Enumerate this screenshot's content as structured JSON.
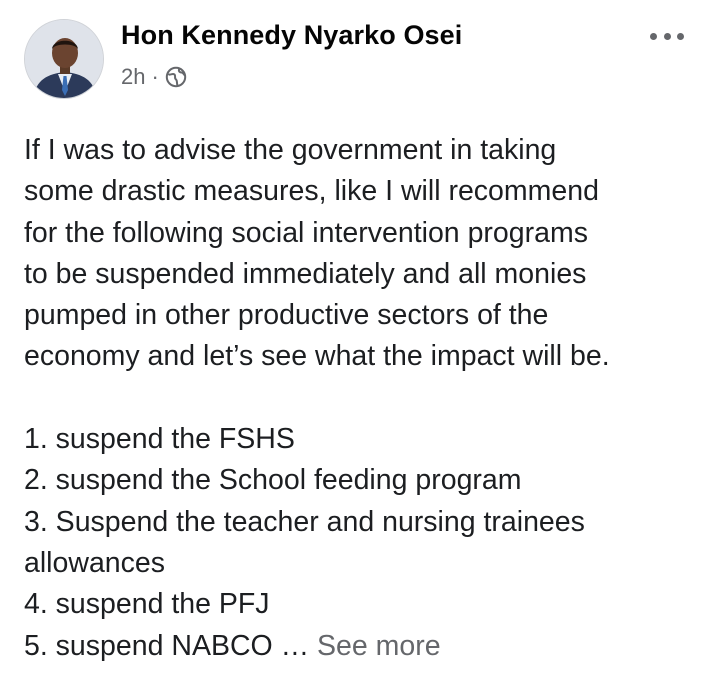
{
  "post": {
    "author": "Hon Kennedy Nyarko Osei",
    "timestamp": "2h",
    "separator": "·",
    "privacy_icon": "globe-icon",
    "options_icon": "more-options-icon",
    "body_lines": [
      "If I was to advise the government in taking",
      "some drastic measures,  like I will recommend",
      "for the following social intervention programs",
      "to be suspended immediately and  all monies",
      "pumped in other productive sectors of the",
      "economy and let’s see what the impact will be."
    ],
    "list_lines": [
      "1. suspend the FSHS",
      "2. suspend the School feeding program",
      "3. Suspend the teacher and nursing trainees",
      "allowances",
      "4. suspend the PFJ"
    ],
    "last_line_text": "5. suspend NABCO … ",
    "see_more": "See more"
  },
  "colors": {
    "primary_text": "#1c1e21",
    "secondary_text": "#65676b",
    "background": "#ffffff"
  }
}
